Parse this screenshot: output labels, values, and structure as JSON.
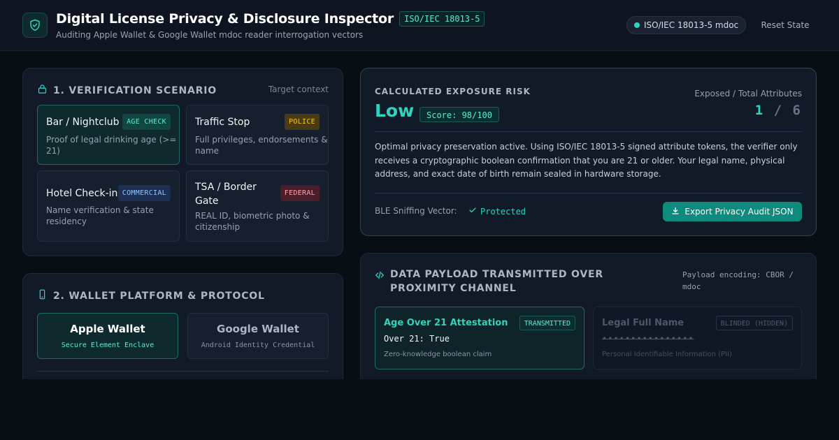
{
  "header": {
    "title": "Digital License Privacy & Disclosure Inspector",
    "standard_badge": "ISO/IEC 18013-5",
    "subtitle": "Auditing Apple Wallet & Google Wallet mdoc reader interrogation vectors",
    "status_pill": "ISO/IEC 18013-5 mdoc",
    "reset_label": "Reset State",
    "accent_color": "#2dd4bf"
  },
  "scenario_panel": {
    "title": "1. VERIFICATION SCENARIO",
    "hint": "Target context",
    "icon": "lock-icon",
    "scenarios": [
      {
        "name": "Bar / Nightclub",
        "tag": "AGE CHECK",
        "desc": "Proof of legal drinking age (>= 21)",
        "active": true
      },
      {
        "name": "Traffic Stop",
        "tag": "POLICE",
        "desc": "Full privileges, endorsements & name",
        "active": false
      },
      {
        "name": "Hotel Check-in",
        "tag": "COMMERCIAL",
        "desc": "Name verification & state residency",
        "active": false
      },
      {
        "name": "TSA / Border Gate",
        "tag": "FEDERAL",
        "desc": "REAL ID, biometric photo & citizenship",
        "active": false
      }
    ]
  },
  "platform_panel": {
    "title": "2. WALLET PLATFORM & PROTOCOL",
    "icon": "phone-icon",
    "platforms": [
      {
        "name": "Apple Wallet",
        "sub": "Secure Element Enclave",
        "active": true
      },
      {
        "name": "Google Wallet",
        "sub": "Android Identity Credential",
        "active": false
      }
    ]
  },
  "risk_panel": {
    "label": "CALCULATED EXPOSURE RISK",
    "level": "Low",
    "score": "Score: 98/100",
    "exposed_label": "Exposed / Total Attributes",
    "exposed": "1",
    "separator": "/",
    "total": "6",
    "description": "Optimal privacy preservation active. Using ISO/IEC 18013-5 signed attribute tokens, the verifier only receives a cryptographic boolean confirmation that you are 21 or older. Your legal name, physical address, and exact date of birth remain sealed in hardware storage.",
    "ble_label": "BLE Sniffing Vector:",
    "ble_status": "Protected",
    "export_label": "Export Privacy Audit JSON"
  },
  "payload_panel": {
    "title": "DATA PAYLOAD TRANSMITTED OVER PROXIMITY CHANNEL",
    "encoding": "Payload encoding: CBOR / mdoc",
    "icon": "code-icon",
    "attributes": [
      {
        "name": "Age Over 21 Attestation",
        "tag": "TRANSMITTED",
        "value": "Over 21: True",
        "foot": "Zero-knowledge boolean claim"
      },
      {
        "name": "Legal Full Name",
        "tag": "BLINDED (HIDDEN)",
        "value": "••••••••••••••••",
        "foot": "Personal Identifiable Information (PII)"
      }
    ]
  }
}
